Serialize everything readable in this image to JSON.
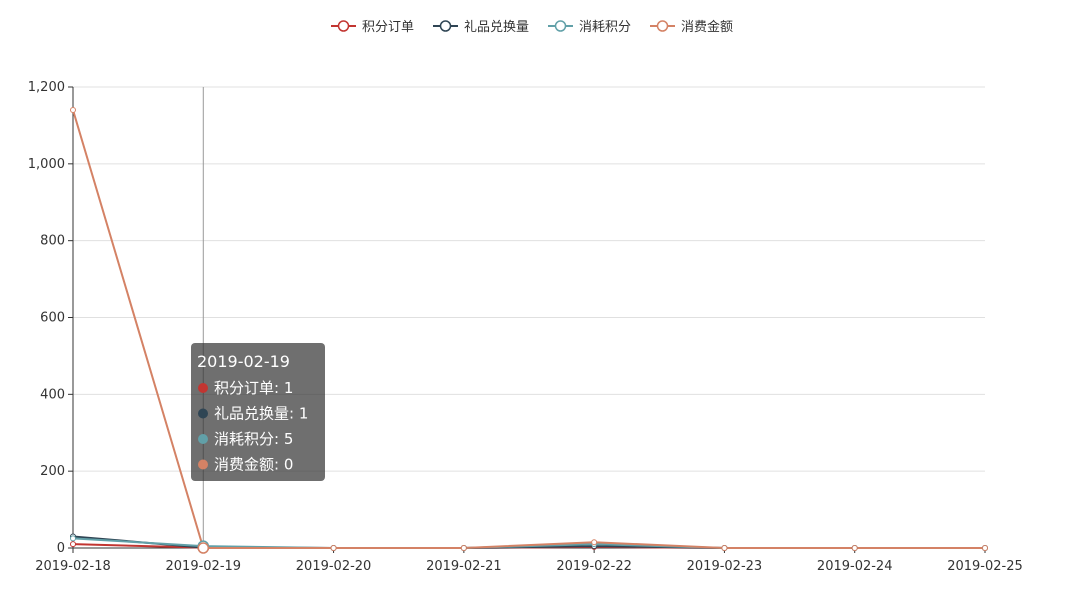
{
  "chart_data": {
    "type": "line",
    "title": "",
    "xlabel": "",
    "ylabel": "",
    "x": [
      "2019-02-18",
      "2019-02-19",
      "2019-02-20",
      "2019-02-21",
      "2019-02-22",
      "2019-02-23",
      "2019-02-24",
      "2019-02-25"
    ],
    "ylim": [
      0,
      1200
    ],
    "yticks": [
      0,
      200,
      400,
      600,
      800,
      1000,
      1200
    ],
    "ytick_labels": [
      "0",
      "200",
      "400",
      "600",
      "800",
      "1,000",
      "1,200"
    ],
    "grid": true,
    "legend_position": "top-center",
    "series": [
      {
        "name": "积分订单",
        "color": "#c23531",
        "values": [
          10,
          1,
          0,
          0,
          3,
          0,
          0,
          0
        ]
      },
      {
        "name": "礼品兑换量",
        "color": "#2f4554",
        "values": [
          30,
          1,
          0,
          0,
          5,
          0,
          0,
          0
        ]
      },
      {
        "name": "消耗积分",
        "color": "#61a0a8",
        "values": [
          25,
          5,
          0,
          0,
          10,
          0,
          0,
          0
        ]
      },
      {
        "name": "消费金额",
        "color": "#d48265",
        "values": [
          1140,
          0,
          0,
          0,
          15,
          0,
          0,
          0
        ]
      }
    ],
    "tooltip": {
      "category": "2019-02-19",
      "rows": [
        {
          "label": "积分订单: 1",
          "color": "#c23531"
        },
        {
          "label": "礼品兑换量: 1",
          "color": "#2f4554"
        },
        {
          "label": "消耗积分: 5",
          "color": "#61a0a8"
        },
        {
          "label": "消费金额: 0",
          "color": "#d48265"
        }
      ]
    }
  }
}
